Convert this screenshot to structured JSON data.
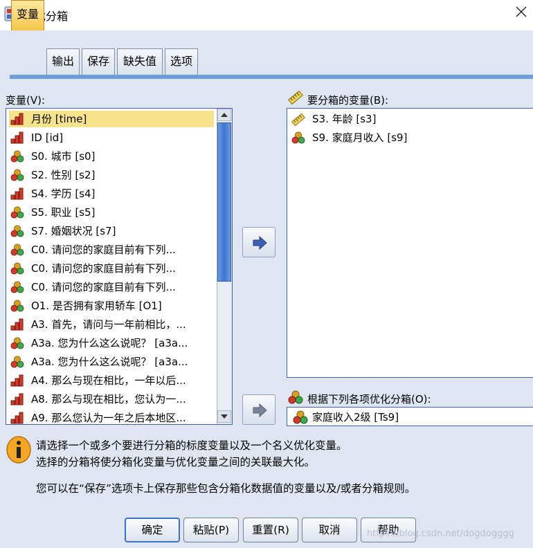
{
  "window": {
    "title": "最优分箱"
  },
  "tabs": [
    {
      "label": "变量",
      "active": true
    },
    {
      "label": "输出",
      "active": false
    },
    {
      "label": "保存",
      "active": false
    },
    {
      "label": "缺失值",
      "active": false
    },
    {
      "label": "选项",
      "active": false
    }
  ],
  "variables": {
    "label": "变量(V):",
    "items": [
      {
        "text": "月份 [time]",
        "icon": "ordinal-bar-icon",
        "selected": true
      },
      {
        "text": "ID [id]",
        "icon": "ordinal-bar-icon",
        "selected": false
      },
      {
        "text": "S0. 城市 [s0]",
        "icon": "nominal-balls-icon",
        "selected": false
      },
      {
        "text": "S2. 性别 [s2]",
        "icon": "nominal-balls-icon",
        "selected": false
      },
      {
        "text": "S4. 学历 [s4]",
        "icon": "ordinal-bar-icon",
        "selected": false
      },
      {
        "text": "S5. 职业 [s5]",
        "icon": "nominal-balls-icon",
        "selected": false
      },
      {
        "text": "S7. 婚姻状况 [s7]",
        "icon": "nominal-balls-icon",
        "selected": false
      },
      {
        "text": "C0. 请问您的家庭目前有下列...",
        "icon": "nominal-balls-icon",
        "selected": false
      },
      {
        "text": "C0. 请问您的家庭目前有下列...",
        "icon": "nominal-balls-icon",
        "selected": false
      },
      {
        "text": "C0. 请问您的家庭目前有下列...",
        "icon": "nominal-balls-icon",
        "selected": false
      },
      {
        "text": "O1. 是否拥有家用轿车 [O1]",
        "icon": "nominal-balls-icon",
        "selected": false
      },
      {
        "text": "A3. 首先，请问与一年前相比，...",
        "icon": "ordinal-bar-icon",
        "selected": false
      },
      {
        "text": "A3a. 您为什么这么说呢？ [a3a...",
        "icon": "nominal-balls-icon",
        "selected": false
      },
      {
        "text": "A3a. 您为什么这么说呢？ [a3a...",
        "icon": "nominal-balls-icon",
        "selected": false
      },
      {
        "text": "A4. 那么与现在相比，一年以后...",
        "icon": "ordinal-bar-icon",
        "selected": false
      },
      {
        "text": "A8. 那么与现在相比，您认为一...",
        "icon": "ordinal-bar-icon",
        "selected": false
      },
      {
        "text": "A9. 那么您认为一年之后本地区...",
        "icon": "ordinal-bar-icon",
        "selected": false
      }
    ]
  },
  "bin_vars": {
    "label": "要分箱的变量(B):",
    "items": [
      {
        "text": "S3. 年龄 [s3]",
        "icon": "scale-ruler-icon"
      },
      {
        "text": "S9. 家庭月收入 [s9]",
        "icon": "nominal-balls-icon"
      }
    ]
  },
  "optimize": {
    "label": "根据下列各项优化分箱(O):",
    "value": "家庭收入2级 [Ts9]"
  },
  "info": {
    "line1": "请选择一个或多个要进行分箱的标度变量以及一个名义优化变量。",
    "line2": "选择的分箱将使分箱化变量与优化变量之间的关联最大化。",
    "line3": "您可以在“保存”选项卡上保存那些包含分箱化数据值的变量以及/或者分箱规则。"
  },
  "buttons": {
    "ok": "确定",
    "paste": "粘贴(P)",
    "reset": "重置(R)",
    "cancel": "取消",
    "help": "帮助"
  },
  "watermark": "https://blog.csdn.net/dogdogggg",
  "colors": {
    "accent": "#3a6fc6",
    "selection": "#f7e38c",
    "tab_active": "#f6c64b"
  }
}
